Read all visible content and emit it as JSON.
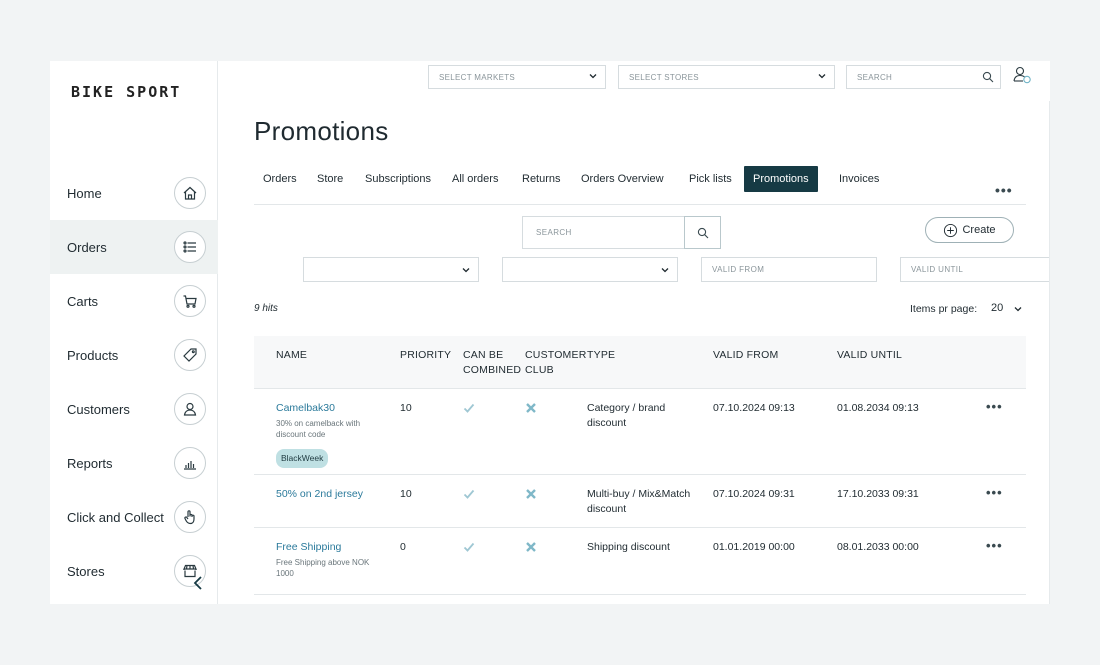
{
  "brand": {
    "logo": "BIKE SPORT"
  },
  "sidebar": {
    "items": [
      {
        "label": "Home",
        "icon": "home-icon",
        "active": false
      },
      {
        "label": "Orders",
        "icon": "list-icon",
        "active": true
      },
      {
        "label": "Carts",
        "icon": "cart-icon",
        "active": false
      },
      {
        "label": "Products",
        "icon": "tag-icon",
        "active": false
      },
      {
        "label": "Customers",
        "icon": "user-icon",
        "active": false
      },
      {
        "label": "Reports",
        "icon": "bar-chart-icon",
        "active": false
      },
      {
        "label": "Click and Collect",
        "icon": "hand-pointer-icon",
        "active": false
      },
      {
        "label": "Stores",
        "icon": "storefront-icon",
        "active": false
      }
    ]
  },
  "topbar": {
    "markets_placeholder": "SELECT MARKETS",
    "stores_placeholder": "SELECT STORES",
    "search_placeholder": "SEARCH"
  },
  "page": {
    "title": "Promotions"
  },
  "tabs": [
    {
      "label": "Orders"
    },
    {
      "label": "Store"
    },
    {
      "label": "Subscriptions"
    },
    {
      "label": "All orders"
    },
    {
      "label": "Returns"
    },
    {
      "label": "Orders Overview"
    },
    {
      "label": "Pick lists"
    },
    {
      "label": "Promotions"
    },
    {
      "label": "Invoices"
    }
  ],
  "more_label": "•••",
  "toolbar": {
    "search_placeholder": "SEARCH",
    "create_label": "Create",
    "valid_from_placeholder": "VALID FROM",
    "valid_until_placeholder": "VALID UNTIL"
  },
  "results": {
    "hits": "9 hits",
    "items_per_page_label": "Items pr page:",
    "items_per_page_value": "20"
  },
  "table": {
    "headers": {
      "name": "NAME",
      "priority": "PRIORITY",
      "combined_1": "CAN BE",
      "combined_2": "COMBINED",
      "club_1": "CUSTOMER",
      "club_2": "CLUB",
      "type": "TYPE",
      "valid_from": "VALID FROM",
      "valid_until": "VALID UNTIL"
    },
    "rows": [
      {
        "name": "Camelbak30",
        "description": "30% on camelback with discount code",
        "badge": "BlackWeek",
        "priority": "10",
        "type": "Category / brand discount",
        "valid_from": "07.10.2024 09:13",
        "valid_until": "01.08.2034 09:13",
        "more": "•••"
      },
      {
        "name": "50% on 2nd jersey",
        "description": "",
        "badge": "",
        "priority": "10",
        "type": "Multi-buy / Mix&Match discount",
        "valid_from": "07.10.2024 09:31",
        "valid_until": "17.10.2033 09:31",
        "more": "•••"
      },
      {
        "name": "Free Shipping",
        "description": "Free Shipping above NOK 1000",
        "badge": "",
        "priority": "0",
        "type": "Shipping discount",
        "valid_from": "01.01.2019 00:00",
        "valid_until": "08.01.2033 00:00",
        "more": "•••"
      }
    ]
  },
  "colors": {
    "accent": "#163a44",
    "link": "#2b7a9b",
    "check": "#9fc7d3",
    "cross": "#7fb8c8",
    "badge_bg": "#bfe0e3"
  }
}
